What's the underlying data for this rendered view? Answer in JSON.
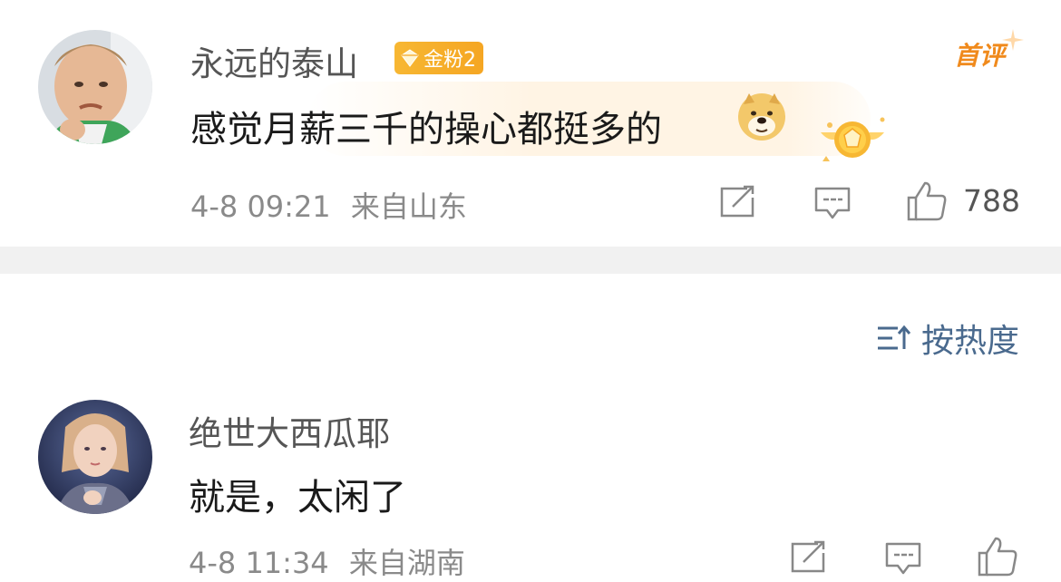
{
  "comments": [
    {
      "username": "永远的泰山",
      "badge": "金粉2",
      "first_tag": "首评",
      "text": "感觉月薪三千的操心都挺多的",
      "emoji": "doge-icon",
      "time": "4-8 09:21",
      "location": "来自山东",
      "likes": "788"
    },
    {
      "username": "绝世大西瓜耶",
      "text": "就是，太闲了",
      "time": "4-8 11:34",
      "location": "来自湖南"
    }
  ],
  "sort": {
    "label": "按热度",
    "icon": "sort-icon"
  },
  "colors": {
    "badge": "#f5a623",
    "first_tag": "#f08a1c",
    "sort": "#4a6a8e",
    "divider": "#f1f1f1"
  }
}
